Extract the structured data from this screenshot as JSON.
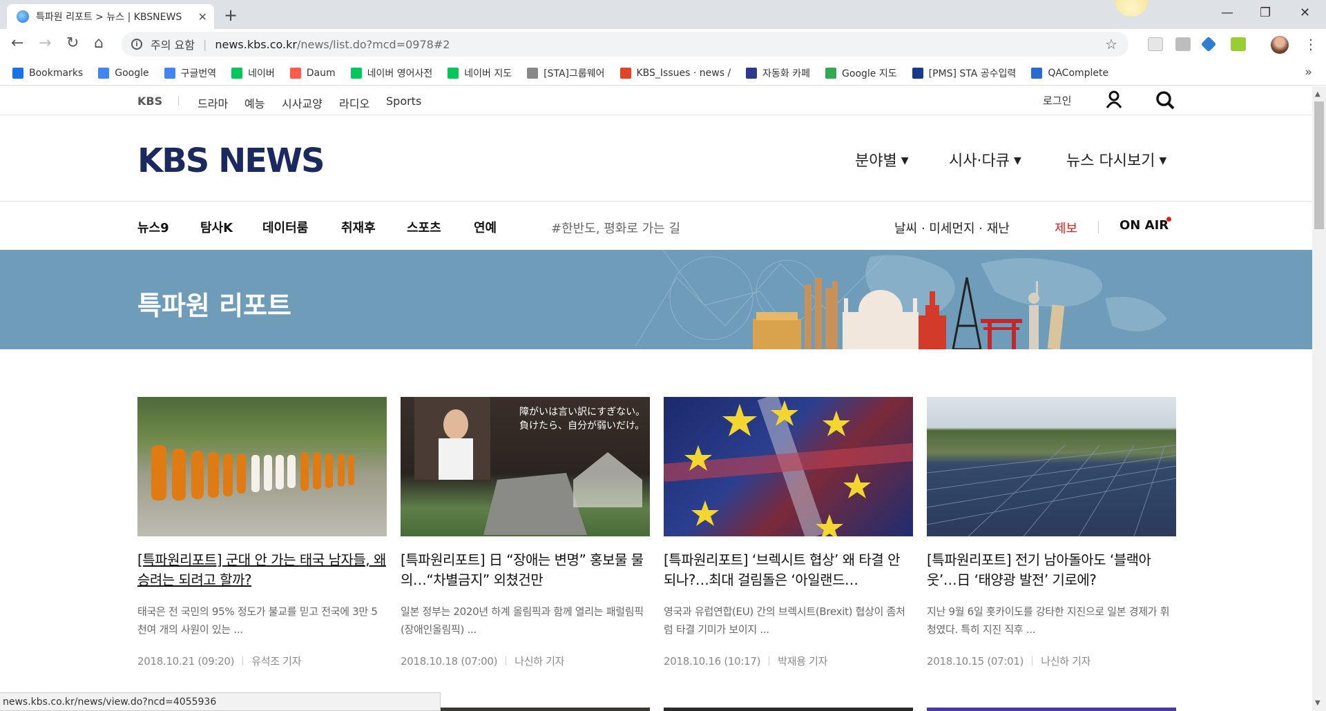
{
  "browser": {
    "tab_title": "특파원 리포트 > 뉴스 | KBSNEWS",
    "new_tab": "+",
    "security_warning": "주의 요함",
    "url_host": "news.kbs.co.kr",
    "url_path": "/news/list.do?mcd=0978#2",
    "status_url": "news.kbs.co.kr/news/view.do?ncd=4055936",
    "bookmarks": [
      {
        "label": "Bookmarks",
        "icon": "star-icon",
        "color": "#1a73e8"
      },
      {
        "label": "Google",
        "icon": "google-icon",
        "color": "#4285f4"
      },
      {
        "label": "구글번역",
        "icon": "translate-icon",
        "color": "#4285f4"
      },
      {
        "label": "네이버",
        "icon": "naver-icon",
        "color": "#03c75a"
      },
      {
        "label": "Daum",
        "icon": "daum-icon",
        "color": "#ff5a4e"
      },
      {
        "label": "네이버 영어사전",
        "icon": "naver-dict-icon",
        "color": "#03c75a"
      },
      {
        "label": "네이버 지도",
        "icon": "naver-map-icon",
        "color": "#03c75a"
      },
      {
        "label": "[STA]그룹웨어",
        "icon": "page-icon",
        "color": "#888888"
      },
      {
        "label": "KBS_Issues · news / ",
        "icon": "gitlab-icon",
        "color": "#e24329"
      },
      {
        "label": "자동화 카페",
        "icon": "sta-icon",
        "color": "#2b3a8c"
      },
      {
        "label": "Google 지도",
        "icon": "maps-icon",
        "color": "#34a853"
      },
      {
        "label": "[PMS] STA 공수입력",
        "icon": "pms-icon",
        "color": "#1a3a8c"
      },
      {
        "label": "QAComplete",
        "icon": "qacomplete-icon",
        "color": "#2a6bd1"
      }
    ]
  },
  "site": {
    "topbar": {
      "brand": "KBS",
      "links": [
        "드라마",
        "예능",
        "시사교양",
        "라디오",
        "Sports"
      ],
      "login": "로그인"
    },
    "logo": "KBS NEWS",
    "categories": [
      "분야별",
      "시사·다큐",
      "뉴스 다시보기"
    ],
    "subnav": [
      "뉴스9",
      "탐사K",
      "데이터룸",
      "취재후",
      "스포츠",
      "연예"
    ],
    "hashtag": "#한반도, 평화로 가는 길",
    "weather": "날씨 · 미세먼지 · 재난",
    "tip": "제보",
    "onair": "ON AIR",
    "banner_title": "특파원 리포트",
    "accent_color": "#6f9cb9"
  },
  "articles": [
    {
      "title": "[특파원리포트] 군대 안 가는 태국 남자들, 왜 승려는 되려고 할까?",
      "desc": "태국은 전 국민의 95% 정도가 불교를 믿고 전국에 3만 5천여 개의 사원이 있는 ...",
      "date": "2018.10.21 (09:20)",
      "author": "유석조 기자"
    },
    {
      "title": "[특파원리포트] 日 “장애는 변명” 홍보물 물의…“차별금지” 외쳤건만",
      "desc": "일본 정부는 2020년 하계 올림픽과 함께 열리는 패럴림픽(장애인올림픽) ...",
      "date": "2018.10.18 (07:00)",
      "author": "나신하 기자",
      "image_text": "障がいは言い訳にすぎない。負けたら、自分が弱いだけ。"
    },
    {
      "title": "[특파원리포트] ‘브렉시트 협상’ 왜 타결 안 되나?…최대 걸림돌은 ‘아일랜드…",
      "desc": "영국과 유럽연합(EU) 간의 브렉시트(Brexit) 협상이 좀처럼 타결 기미가 보이지 ...",
      "date": "2018.10.16 (10:17)",
      "author": "박재용 기자"
    },
    {
      "title": "[특파원리포트] 전기 남아돌아도 ‘블랙아웃’…日 ‘태양광 발전’ 기로에?",
      "desc": "지난 9월 6일 홋카이도를 강타한 지진으로 일본 경제가 휘청였다. 특히 지진 직후 ...",
      "date": "2018.10.15 (07:01)",
      "author": "나신하 기자"
    }
  ]
}
